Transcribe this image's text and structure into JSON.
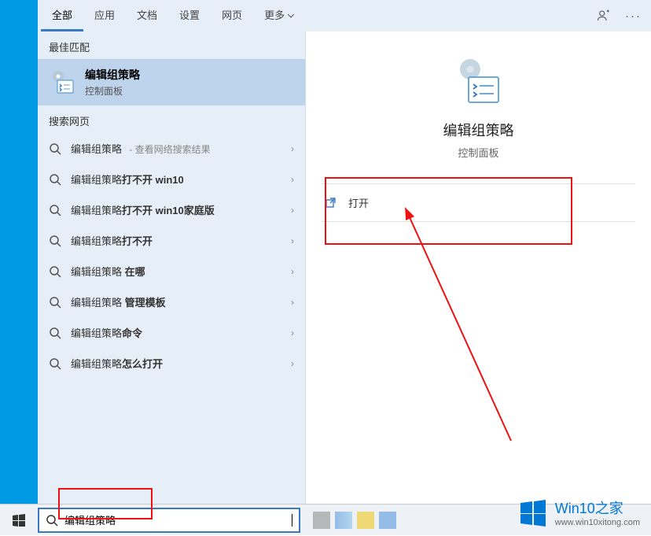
{
  "tabs": {
    "all": "全部",
    "apps": "应用",
    "docs": "文档",
    "settings": "设置",
    "web": "网页",
    "more": "更多"
  },
  "sections": {
    "best_match": "最佳匹配",
    "search_web": "搜索网页"
  },
  "best_match": {
    "title": "编辑组策略",
    "subtitle": "控制面板"
  },
  "web_results": [
    {
      "text": "编辑组策略",
      "hint": "查看网络搜索结果"
    },
    {
      "text": "编辑组策略打不开 win10",
      "hint": ""
    },
    {
      "text": "编辑组策略打不开 win10家庭版",
      "hint": ""
    },
    {
      "text": "编辑组策略打不开",
      "hint": ""
    },
    {
      "text": "编辑组策略 在哪",
      "hint": ""
    },
    {
      "text": "编辑组策略 管理模板",
      "hint": ""
    },
    {
      "text": "编辑组策略命令",
      "hint": ""
    },
    {
      "text": "编辑组策略怎么打开",
      "hint": ""
    }
  ],
  "detail": {
    "title": "编辑组策略",
    "subtitle": "控制面板",
    "open_label": "打开"
  },
  "search_input": {
    "value": "编辑组策略"
  },
  "watermark": {
    "brand": "Win10之家",
    "url": "www.win10xitong.com"
  }
}
